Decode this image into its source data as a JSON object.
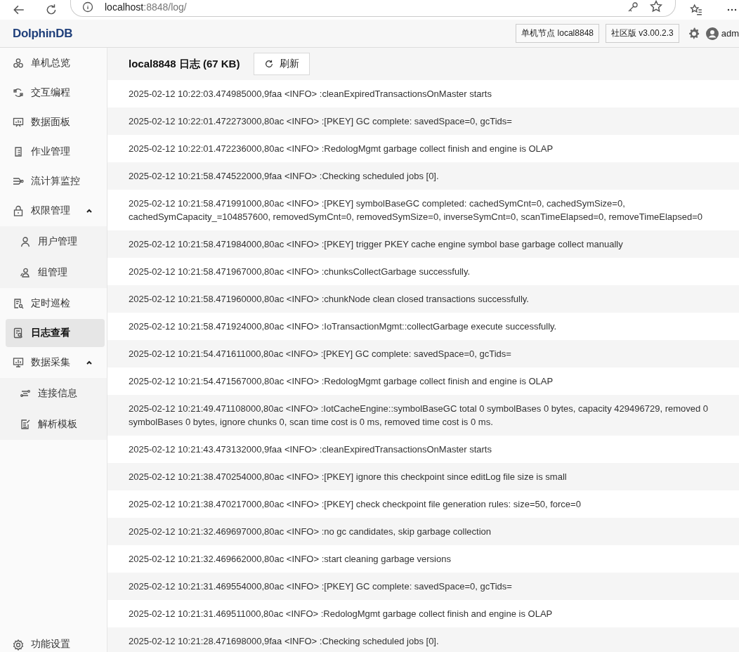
{
  "browser": {
    "url_host": "localhost",
    "url_path": ":8848/log/"
  },
  "header": {
    "logo": "DolphinDB",
    "node_tag": "单机节点 local8848",
    "edition_tag": "社区版 v3.00.2.3",
    "user": "adm"
  },
  "sidebar": {
    "items": [
      {
        "kind": "item",
        "label": "单机总览",
        "selected": false
      },
      {
        "kind": "item",
        "label": "交互编程",
        "selected": false
      },
      {
        "kind": "item",
        "label": "数据面板",
        "selected": false
      },
      {
        "kind": "item",
        "label": "作业管理",
        "selected": false
      },
      {
        "kind": "item",
        "label": "流计算监控",
        "selected": false
      },
      {
        "kind": "group",
        "label": "权限管理",
        "selected": false,
        "expanded": true,
        "children": [
          {
            "label": "用户管理",
            "selected": false
          },
          {
            "label": "组管理",
            "selected": false
          }
        ]
      },
      {
        "kind": "item",
        "label": "定时巡检",
        "selected": false
      },
      {
        "kind": "item",
        "label": "日志查看",
        "selected": true
      },
      {
        "kind": "group",
        "label": "数据采集",
        "selected": false,
        "expanded": true,
        "children": [
          {
            "label": "连接信息",
            "selected": false
          },
          {
            "label": "解析模板",
            "selected": false
          }
        ]
      }
    ],
    "footer_item": "功能设置"
  },
  "log": {
    "title": "local8848 日志 (67 KB)",
    "refresh_button": "刷新",
    "lines": [
      "2025-02-12 10:22:03.474985000,9faa <INFO> :cleanExpiredTransactionsOnMaster starts",
      "2025-02-12 10:22:01.472273000,80ac <INFO> :[PKEY] GC complete: savedSpace=0, gcTids=",
      "2025-02-12 10:22:01.472236000,80ac <INFO> :RedologMgmt garbage collect finish and engine is OLAP",
      "2025-02-12 10:21:58.474522000,9faa <INFO> :Checking scheduled jobs [0].",
      "2025-02-12 10:21:58.471991000,80ac <INFO> :[PKEY] symbolBaseGC completed: cachedSymCnt=0, cachedSymSize=0, cachedSymCapacity_=104857600, removedSymCnt=0, removedSymSize=0, inverseSymCnt=0, scanTimeElapsed=0, removeTimeElapsed=0",
      "2025-02-12 10:21:58.471984000,80ac <INFO> :[PKEY] trigger PKEY cache engine symbol base garbage collect manually",
      "2025-02-12 10:21:58.471967000,80ac <INFO> :chunksCollectGarbage successfully.",
      "2025-02-12 10:21:58.471960000,80ac <INFO> :chunkNode clean closed transactions successfully.",
      "2025-02-12 10:21:58.471924000,80ac <INFO> :IoTransactionMgmt::collectGarbage execute successfully.",
      "2025-02-12 10:21:54.471611000,80ac <INFO> :[PKEY] GC complete: savedSpace=0, gcTids=",
      "2025-02-12 10:21:54.471567000,80ac <INFO> :RedologMgmt garbage collect finish and engine is OLAP",
      "2025-02-12 10:21:49.471108000,80ac <INFO> :IotCacheEngine::symbolBaseGC total 0 symbolBases 0 bytes, capacity 429496729, removed 0 symbolBases 0 bytes, ignore chunks 0, scan time cost is 0 ms, removed time cost is 0 ms.",
      "2025-02-12 10:21:43.473132000,9faa <INFO> :cleanExpiredTransactionsOnMaster starts",
      "2025-02-12 10:21:38.470254000,80ac <INFO> :[PKEY] ignore this checkpoint since editLog file size is small",
      "2025-02-12 10:21:38.470217000,80ac <INFO> :[PKEY] check checkpoint file generation rules: size=50, force=0",
      "2025-02-12 10:21:32.469697000,80ac <INFO> :no gc candidates, skip garbage collection",
      "2025-02-12 10:21:32.469662000,80ac <INFO> :start cleaning garbage versions",
      "2025-02-12 10:21:31.469554000,80ac <INFO> :[PKEY] GC complete: savedSpace=0, gcTids=",
      "2025-02-12 10:21:31.469511000,80ac <INFO> :RedologMgmt garbage collect finish and engine is OLAP",
      "2025-02-12 10:21:28.471698000,9faa <INFO> :Checking scheduled jobs [0]."
    ]
  }
}
